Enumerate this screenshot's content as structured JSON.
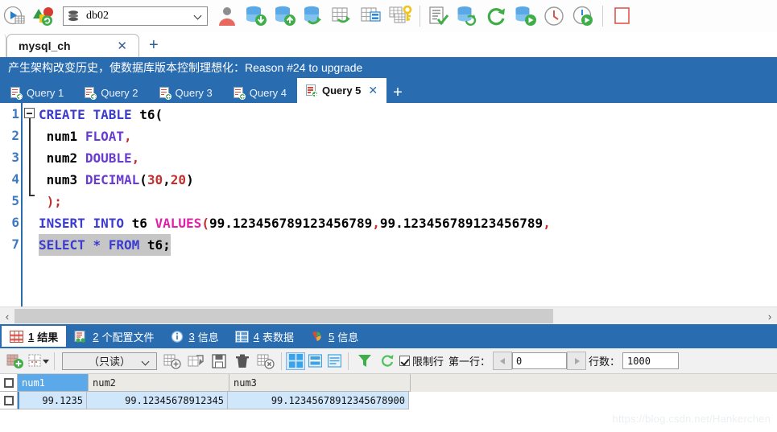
{
  "toolbar": {
    "database_value": "db02",
    "icons": [
      "run-query-icon",
      "schema-sync-icon",
      "database-select-icon",
      "user-icon",
      "database-import-icon",
      "database-export-icon",
      "database-transfer-icon",
      "table-export-icon",
      "table-data-icon",
      "table-key-icon",
      "script-check-icon",
      "database-refresh-icon",
      "refresh-icon",
      "database-run-icon",
      "history-clock-icon",
      "scheduled-run-icon",
      "stop-icon"
    ]
  },
  "connection_tabs": {
    "active": "mysql_ch",
    "close_label": "✕",
    "add_label": "+"
  },
  "banner": {
    "text": "产生架构改变历史，使数据库版本控制理想化：Reason #24 to upgrade",
    "background": "#2a6cb0"
  },
  "query_tabs": {
    "items": [
      {
        "label": "Query 1",
        "active": false
      },
      {
        "label": "Query 2",
        "active": false
      },
      {
        "label": "Query 3",
        "active": false
      },
      {
        "label": "Query 4",
        "active": false
      },
      {
        "label": "Query 5",
        "active": true
      }
    ],
    "close_label": "✕",
    "add_label": "+"
  },
  "editor": {
    "line_numbers": [
      "1",
      "2",
      "3",
      "4",
      "5",
      "6",
      "7"
    ],
    "lines": [
      {
        "n": "1",
        "tokens": [
          {
            "t": "CREATE",
            "c": "kw"
          },
          {
            "t": " ",
            "c": "punct"
          },
          {
            "t": "TABLE",
            "c": "kw"
          },
          {
            "t": " ",
            "c": "punct"
          },
          {
            "t": "t6",
            "c": "id"
          },
          {
            "t": "(",
            "c": "punct"
          }
        ]
      },
      {
        "n": "2",
        "tokens": [
          {
            "t": "num1",
            "c": "id"
          },
          {
            "t": " ",
            "c": "punct"
          },
          {
            "t": "FLOAT",
            "c": "kw2"
          },
          {
            "t": ",",
            "c": "num"
          }
        ]
      },
      {
        "n": "3",
        "tokens": [
          {
            "t": "num2",
            "c": "id"
          },
          {
            "t": " ",
            "c": "punct"
          },
          {
            "t": "DOUBLE",
            "c": "kw2"
          },
          {
            "t": ",",
            "c": "num"
          }
        ]
      },
      {
        "n": "4",
        "tokens": [
          {
            "t": "num3",
            "c": "id"
          },
          {
            "t": " ",
            "c": "punct"
          },
          {
            "t": "DECIMAL",
            "c": "kw2"
          },
          {
            "t": "(",
            "c": "punct"
          },
          {
            "t": "30",
            "c": "num"
          },
          {
            "t": ",",
            "c": "punct"
          },
          {
            "t": "20",
            "c": "num"
          },
          {
            "t": ")",
            "c": "punct"
          }
        ]
      },
      {
        "n": "5",
        "tokens": [
          {
            "t": ")",
            "c": "num"
          },
          {
            "t": ";",
            "c": "num"
          }
        ]
      },
      {
        "n": "6",
        "tokens": [
          {
            "t": "INSERT",
            "c": "kw"
          },
          {
            "t": " ",
            "c": "punct"
          },
          {
            "t": "INTO",
            "c": "kw"
          },
          {
            "t": " ",
            "c": "punct"
          },
          {
            "t": "t6",
            "c": "id"
          },
          {
            "t": " ",
            "c": "punct"
          },
          {
            "t": "VALUES",
            "c": "fn"
          },
          {
            "t": "(",
            "c": "num"
          },
          {
            "t": "99.123456789123456789",
            "c": "punct"
          },
          {
            "t": ",",
            "c": "num"
          },
          {
            "t": "99.123456789123456789",
            "c": "punct"
          },
          {
            "t": ",",
            "c": "num"
          }
        ]
      },
      {
        "n": "7",
        "highlight": true,
        "tokens": [
          {
            "t": "SELECT",
            "c": "kw"
          },
          {
            "t": " ",
            "c": "punct"
          },
          {
            "t": "*",
            "c": "kw"
          },
          {
            "t": " ",
            "c": "punct"
          },
          {
            "t": "FROM",
            "c": "kw"
          },
          {
            "t": " ",
            "c": "punct"
          },
          {
            "t": "t6",
            "c": "id"
          },
          {
            "t": ";",
            "c": "punct"
          }
        ]
      }
    ],
    "scroll_left_label": "‹",
    "scroll_right_label": "›"
  },
  "result_tabs": {
    "items": [
      {
        "num": "1",
        "label": "结果",
        "icon": "result-grid-icon",
        "active": true
      },
      {
        "num": "2",
        "label": "个配置文件",
        "icon": "profile-icon",
        "active": false
      },
      {
        "num": "3",
        "label": "信息",
        "icon": "info-icon",
        "active": false
      },
      {
        "num": "4",
        "label": "表数据",
        "icon": "table-data-icon",
        "active": false
      },
      {
        "num": "5",
        "label": "信息",
        "icon": "chart-icon",
        "active": false
      }
    ]
  },
  "result_toolbar": {
    "mode_value": "（只读）",
    "limit_label": "限制行",
    "limit_checked": true,
    "first_row_label": "第一行：",
    "first_row_value": "0",
    "row_count_label": "行数：",
    "row_count_value": "1000",
    "prev_label": "◀",
    "next_label": "▶",
    "icons": [
      "add-record-icon",
      "grid-options-icon",
      "insert-record-icon",
      "duplicate-record-icon",
      "save-record-icon",
      "delete-record-icon",
      "cancel-edit-icon",
      "grid-view-icon",
      "form-view-icon",
      "text-view-icon",
      "filter-icon",
      "refresh-result-icon"
    ]
  },
  "grid": {
    "columns": [
      "num1",
      "num2",
      "num3"
    ],
    "selected_column": "num1",
    "rows": [
      [
        "99.1235",
        "99.12345678912345",
        "99.12345678912345678900"
      ]
    ]
  },
  "watermark": "https://blog.csdn.net/Hankerchen"
}
